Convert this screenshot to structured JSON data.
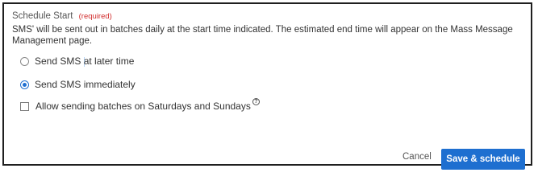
{
  "schedule": {
    "title": "Schedule Start",
    "required_label": "(required)",
    "description": "SMS' will be sent out in batches daily at the start time indicated. The estimated end time will appear on the Mass Message Management page.",
    "options": {
      "later": {
        "label_start": "Send SMS ",
        "label_cursor": "a",
        "label_end": "t later time",
        "selected": false
      },
      "immediately": {
        "label": "Send SMS immediately",
        "selected": true
      }
    },
    "weekend": {
      "label": "Allow sending batches on Saturdays and Sundays",
      "checked": false,
      "help_glyph": "?"
    }
  },
  "actions": {
    "cancel_label": "Cancel",
    "save_label": "Save & schedule"
  },
  "colors": {
    "accent": "#1e6fd0",
    "required": "#d22d2d",
    "border": "#1f1f1f"
  },
  "icons": {
    "help": "help-circle-icon"
  }
}
